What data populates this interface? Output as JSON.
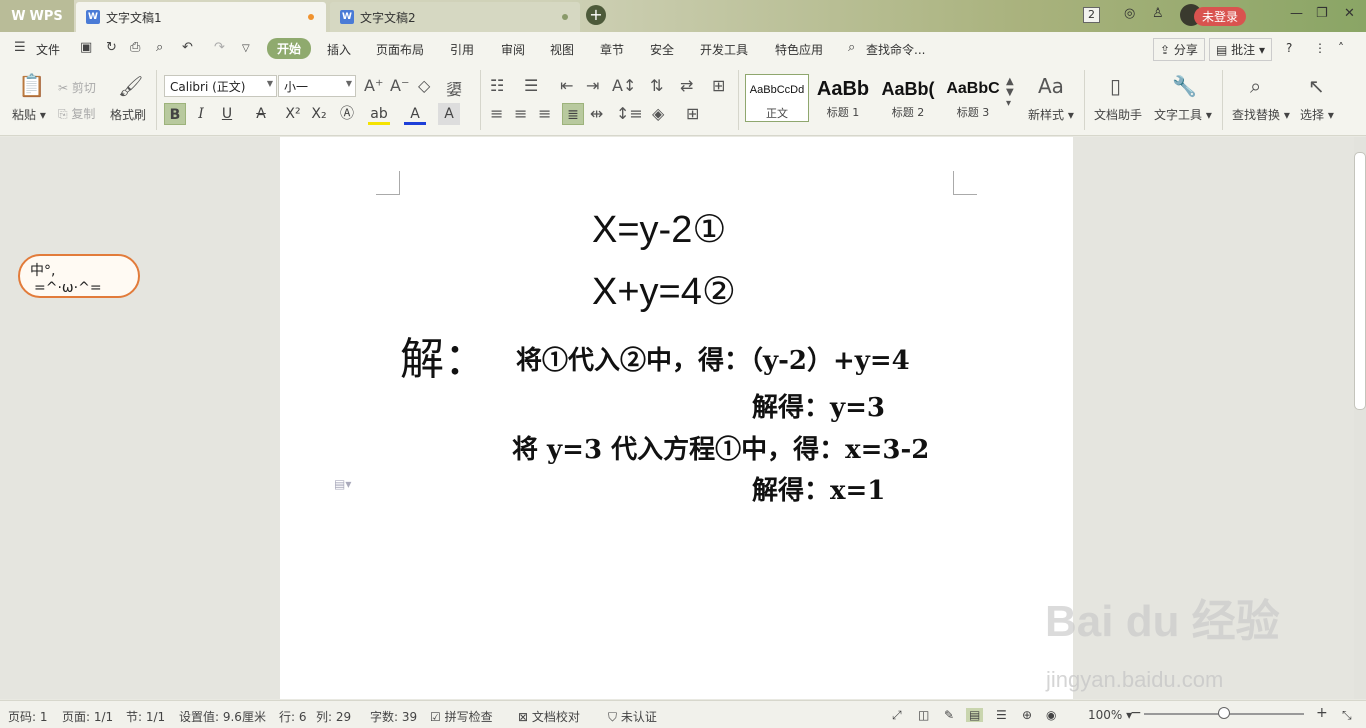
{
  "titlebar": {
    "app_label": "WPS",
    "tabs": [
      {
        "label": "文字文稿1",
        "modified_dot_color": "#f0922e"
      },
      {
        "label": "文字文稿2",
        "modified_dot_color": "#8a9a6a"
      }
    ],
    "new_tab": "+",
    "count_badge": "2",
    "login_label": "未登录"
  },
  "menubar": {
    "file_label": "文件",
    "items": [
      "开始",
      "插入",
      "页面布局",
      "引用",
      "审阅",
      "视图",
      "章节",
      "安全",
      "开发工具",
      "特色应用"
    ],
    "search_label": "查找命令...",
    "share_label": "分享",
    "comment_label": "批注",
    "help_label": "?"
  },
  "ribbon": {
    "paste_label": "粘贴",
    "cut_label": "剪切",
    "copy_label": "复制",
    "format_painter_label": "格式刷",
    "font_name": "Calibri (正文)",
    "font_size": "小一",
    "styles": [
      {
        "sample": "AaBbCcDd",
        "name": "正文"
      },
      {
        "sample": "AaBb",
        "name": "标题 1"
      },
      {
        "sample": "AaBb(",
        "name": "标题 2"
      },
      {
        "sample": "AaBbC",
        "name": "标题 3"
      }
    ],
    "new_style_label": "新样式",
    "doc_assistant_label": "文档助手",
    "text_tools_label": "文字工具",
    "find_replace_label": "查找替换",
    "select_label": "选择"
  },
  "document": {
    "eq1": "X=y-2①",
    "eq2": "X+y=4②",
    "solve_label": "解：",
    "step1": "将①代入②中，得：（y-2）+y=4",
    "step2": "解得：y=3",
    "step3": "将 y=3 代入方程①中，得：x=3-2",
    "step4": "解得：x=1"
  },
  "ime": {
    "label": "中°,"
  },
  "statusbar": {
    "page_num": "页码: 1",
    "page_total": "页面: 1/1",
    "section": "节: 1/1",
    "setting": "设置值: 9.6厘米",
    "row": "行: 6",
    "col": "列: 29",
    "word_count": "字数: 39",
    "spellcheck": "拼写检查",
    "proofread": "文档校对",
    "auth": "未认证",
    "zoom": "100%",
    "zoom_level": 0.5
  },
  "watermark": {
    "main": "Bai du 经验",
    "sub": "jingyan.baidu.com"
  },
  "colors": {
    "accent": "#8faa6e",
    "login": "#d9534f"
  }
}
